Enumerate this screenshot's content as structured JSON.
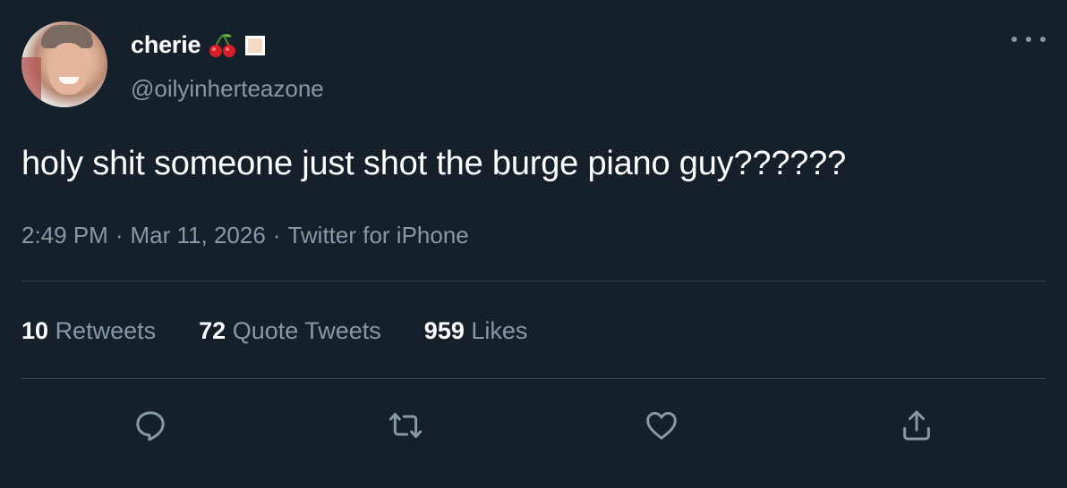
{
  "user": {
    "display_name": "cherie",
    "handle": "@oilyinherteazone",
    "name_emojis": [
      "cherries-emoji",
      "light-skin-tone-square"
    ]
  },
  "tweet": {
    "text": "holy shit someone just shot the burge piano guy??????",
    "time": "2:49 PM",
    "date": "Mar 11, 2026",
    "source": "Twitter for iPhone",
    "separator": "·"
  },
  "stats": {
    "retweets_count": "10",
    "retweets_label": "Retweets",
    "quotes_count": "72",
    "quotes_label": "Quote Tweets",
    "likes_count": "959",
    "likes_label": "Likes"
  },
  "icons": {
    "reply": "reply-icon",
    "retweet": "retweet-icon",
    "like": "heart-icon",
    "share": "share-icon",
    "more": "more-options-icon"
  },
  "colors": {
    "background": "#15202b",
    "primary_text": "#ffffff",
    "secondary_text": "#8899a6",
    "divider": "#38444d"
  }
}
